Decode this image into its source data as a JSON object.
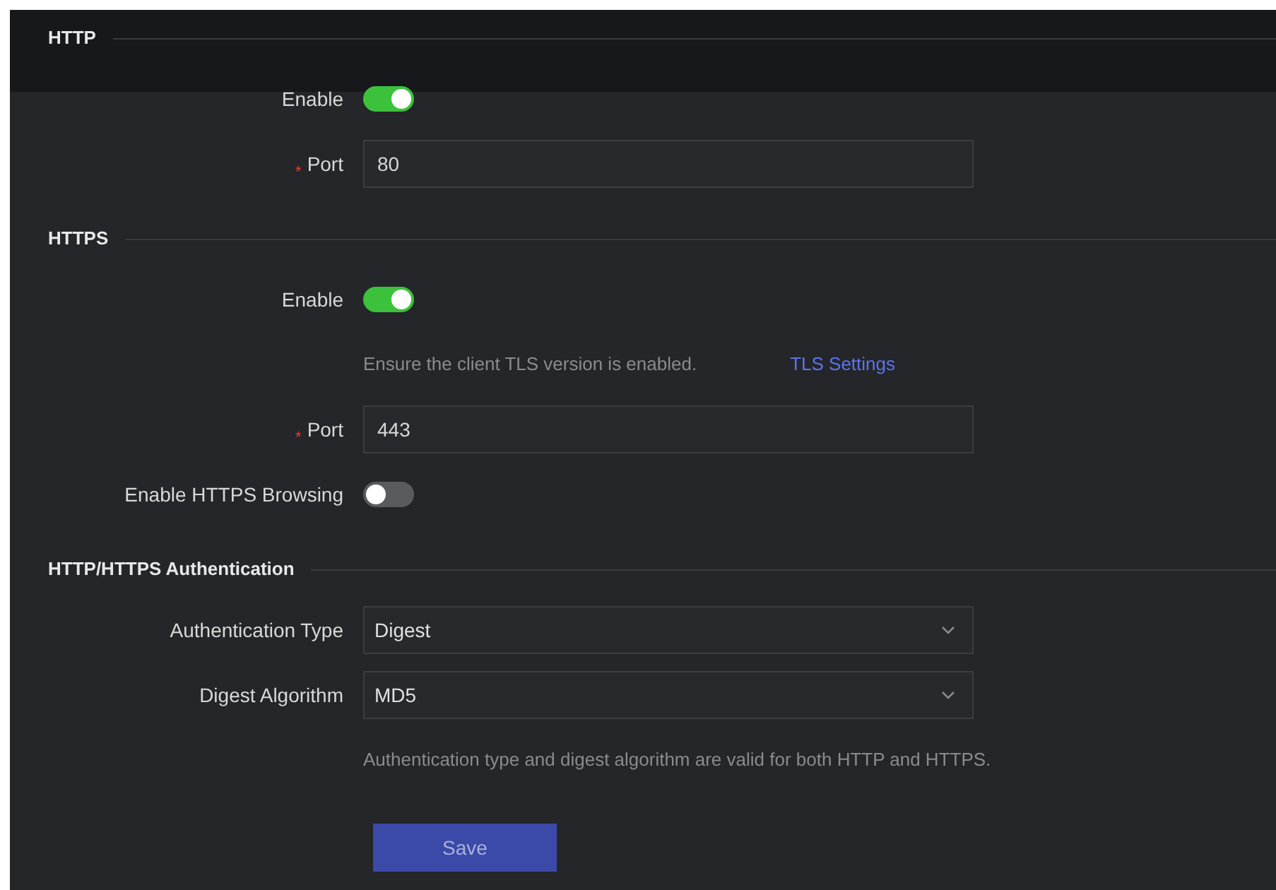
{
  "sections": [
    {
      "title": "HTTP",
      "rows": [
        {
          "kind": "toggle",
          "label": "Enable",
          "on": true
        },
        {
          "kind": "input",
          "label": "Port",
          "required_mark": "*",
          "value": "80"
        }
      ]
    },
    {
      "title": "HTTPS",
      "rows": [
        {
          "kind": "toggle",
          "label": "Enable",
          "on": true
        },
        {
          "kind": "note",
          "text": "Ensure the client TLS version is enabled.",
          "link": "TLS Settings"
        },
        {
          "kind": "input",
          "label": "Port",
          "required_mark": "*",
          "value": "443"
        },
        {
          "kind": "toggle",
          "label": "Enable HTTPS Browsing",
          "on": false
        }
      ]
    },
    {
      "title": "HTTP/HTTPS Authentication",
      "rows": [
        {
          "kind": "select",
          "label": "Authentication Type",
          "value": "Digest"
        },
        {
          "kind": "select",
          "label": "Digest Algorithm",
          "value": "MD5"
        },
        {
          "kind": "note",
          "text": "Authentication type and digest algorithm are valid for both HTTP and HTTPS."
        }
      ]
    }
  ],
  "save_button": "Save"
}
